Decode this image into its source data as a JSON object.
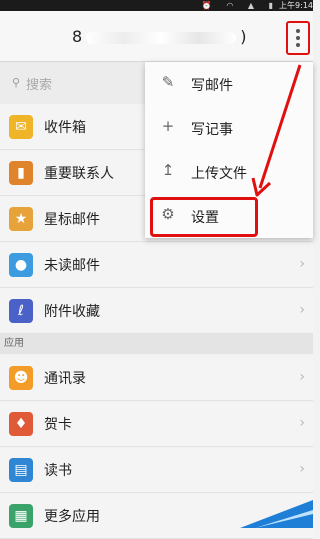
{
  "status_bar": {
    "time": "上午9:14",
    "icons": [
      "alarm-icon",
      "wifi-icon",
      "signal-icon",
      "battery-icon"
    ]
  },
  "header": {
    "account_prefix": "8",
    "account_suffix": ")",
    "menu_icon": "more-vertical-icon"
  },
  "search": {
    "placeholder": "搜索"
  },
  "folders": [
    {
      "label": "收件箱",
      "icon": "inbox-icon",
      "color": "#f0b429"
    },
    {
      "label": "重要联系人",
      "icon": "bookmark-icon",
      "color": "#e0842c"
    },
    {
      "label": "星标邮件",
      "icon": "star-icon",
      "color": "#e8a23a"
    },
    {
      "label": "未读邮件",
      "icon": "unread-dot-icon",
      "color": "#3d9be0"
    },
    {
      "label": "附件收藏",
      "icon": "attachment-icon",
      "color": "#4a62c8"
    }
  ],
  "apps_section": {
    "title": "应用"
  },
  "apps": [
    {
      "label": "通讯录",
      "icon": "contacts-icon",
      "color": "#f39c28"
    },
    {
      "label": "贺卡",
      "icon": "card-icon",
      "color": "#e05a38"
    },
    {
      "label": "读书",
      "icon": "book-icon",
      "color": "#2f86d4"
    },
    {
      "label": "更多应用",
      "icon": "grid-icon",
      "color": "#3aa36a"
    }
  ],
  "popup_menu": [
    {
      "label": "写邮件",
      "icon": "compose-icon"
    },
    {
      "label": "写记事",
      "icon": "plus-icon"
    },
    {
      "label": "上传文件",
      "icon": "upload-icon"
    },
    {
      "label": "设置",
      "icon": "gear-icon"
    }
  ],
  "annotation": {
    "color": "#e01010"
  }
}
